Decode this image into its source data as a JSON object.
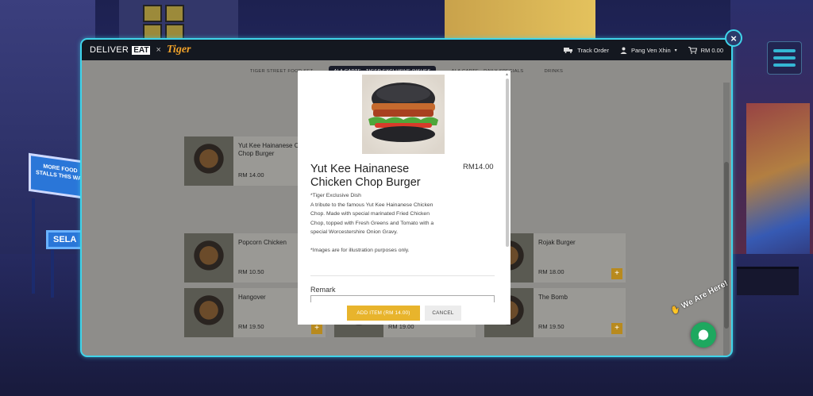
{
  "header": {
    "brand_deliver": "DELIVER",
    "brand_eat": "EAT",
    "brand_x": "×",
    "brand_tiger": "Tiger",
    "track_order": "Track Order",
    "user_name": "Pang Ven Xhin",
    "cart_total": "RM 0.00"
  },
  "categories": [
    {
      "label": "TIGER STREET FOOD SET"
    },
    {
      "label": "ALA CARTE - TIGER EXCLUSIVE DISHES",
      "active": true
    },
    {
      "label": "ALA CARTE - DAILY SPECIALS"
    },
    {
      "label": "DRINKS"
    }
  ],
  "background_signs": {
    "sign1": "MORE FOOD STALLS THIS WAY",
    "sign2": "SELA"
  },
  "menu_items": [
    {
      "name": "Yut Kee Hainanese Chicken Chop Burger",
      "price": "RM 14.00"
    },
    {
      "name": "Popcorn Chicken",
      "price": "RM 10.50"
    },
    {
      "name": "Rojak Burger",
      "price": "RM 18.00"
    },
    {
      "name": "Hangover",
      "price": "RM 19.50"
    },
    {
      "name": "",
      "price": "RM 19.00"
    },
    {
      "name": "The Bomb",
      "price": "RM 19.50"
    }
  ],
  "dialog": {
    "title": "Yut Kee Hainanese Chicken Chop Burger",
    "price": "RM14.00",
    "desc_line1": "*Tiger Exclusive Dish",
    "desc_line2": "A tribute to the famous Yut Kee Hainanese Chicken Chop. Made with special marinated Fried Chicken Chop, topped with Fresh Greens and Tomato with a special Worcestershire Onion Gravy.",
    "desc_line3": "*Images are for illustration purposes only.",
    "remark_label": "Remark",
    "add_button": "ADD ITEM (RM 14.00)",
    "cancel_button": "CANCEL"
  },
  "chat": {
    "label": "We Are Here!"
  },
  "colors": {
    "accent_cyan": "#3fd4ea",
    "add_button": "#e8b42c",
    "chat_green": "#1ea85f"
  }
}
